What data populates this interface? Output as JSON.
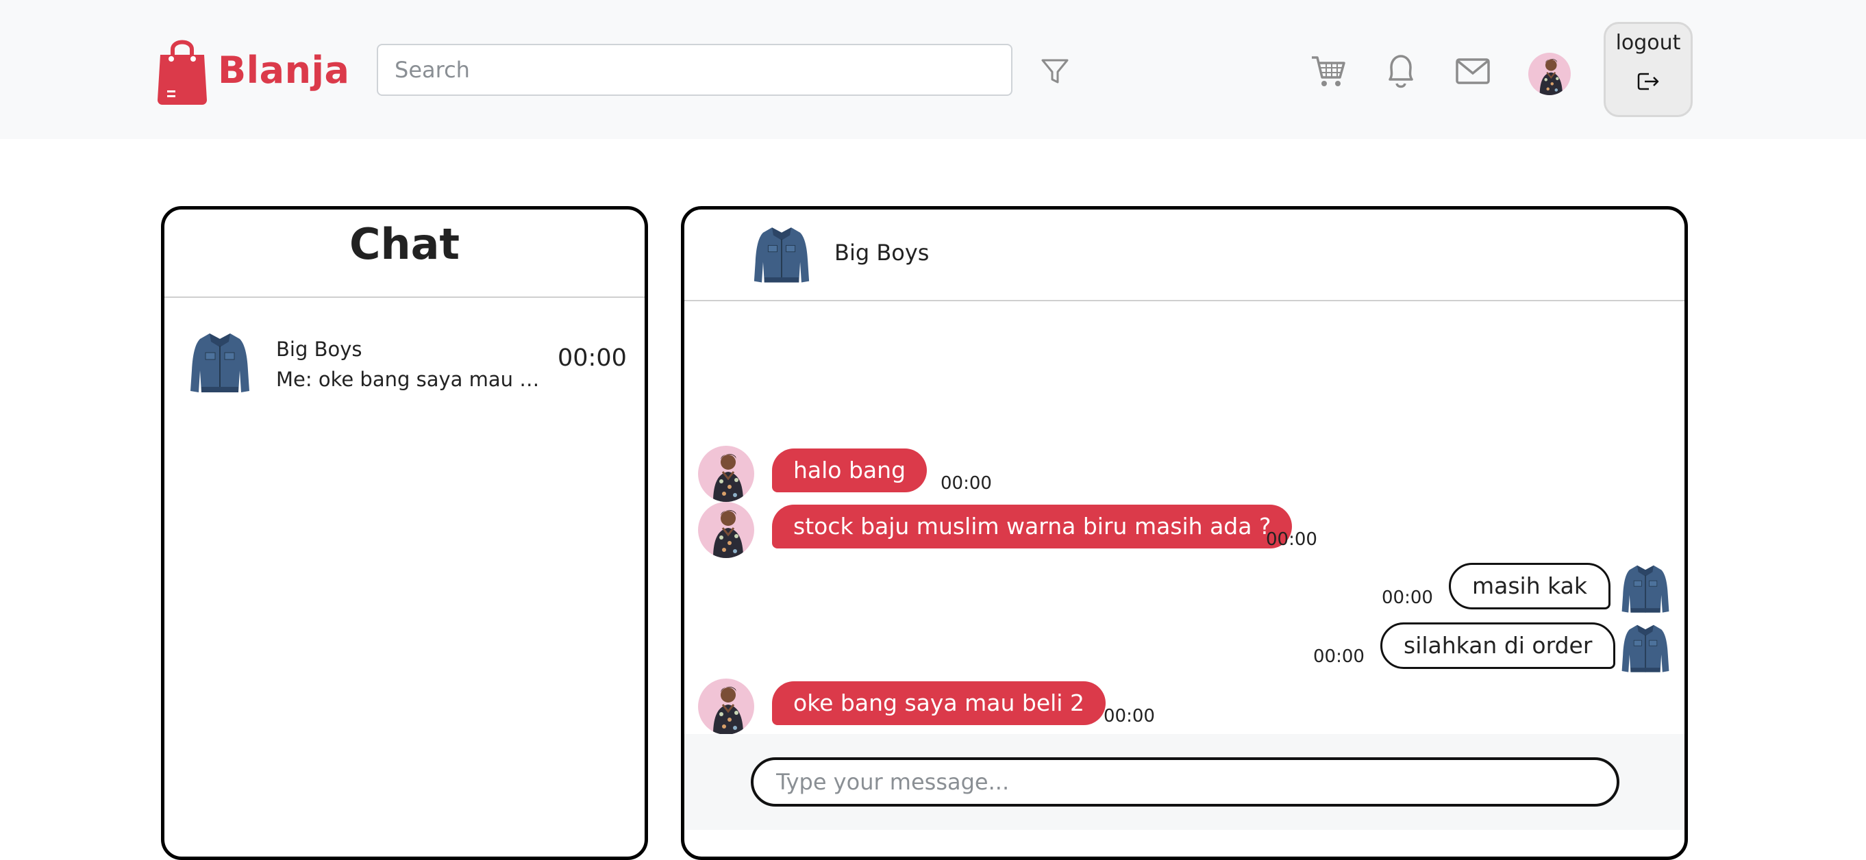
{
  "header": {
    "brand_name": "Blanja",
    "search_placeholder": "Search",
    "logout_label": "logout",
    "brand_color": "#db3a4a",
    "icons": [
      "shopping-bag-icon",
      "filter-icon",
      "cart-icon",
      "bell-icon",
      "mail-icon",
      "user-avatar",
      "logout-icon"
    ]
  },
  "chat_list": {
    "title": "Chat",
    "items": [
      {
        "name": "Big Boys",
        "preview": "Me: oke bang saya mau be...",
        "time": "00:00",
        "thumb_icon": "denim-jacket-icon"
      }
    ]
  },
  "room": {
    "contact_name": "Big Boys",
    "contact_icon": "denim-jacket-icon",
    "messages": [
      {
        "direction": "incoming",
        "text": "halo bang",
        "time": "00:00"
      },
      {
        "direction": "incoming",
        "text": "stock baju muslim warna biru masih ada ?",
        "time": "00:00"
      },
      {
        "direction": "outgoing",
        "text": "masih kak",
        "time": "00:00"
      },
      {
        "direction": "outgoing",
        "text": "silahkan di order",
        "time": "00:00"
      },
      {
        "direction": "incoming",
        "text": "oke bang saya mau beli 2",
        "time": "00:00"
      }
    ],
    "input_placeholder": "Type your message..."
  }
}
